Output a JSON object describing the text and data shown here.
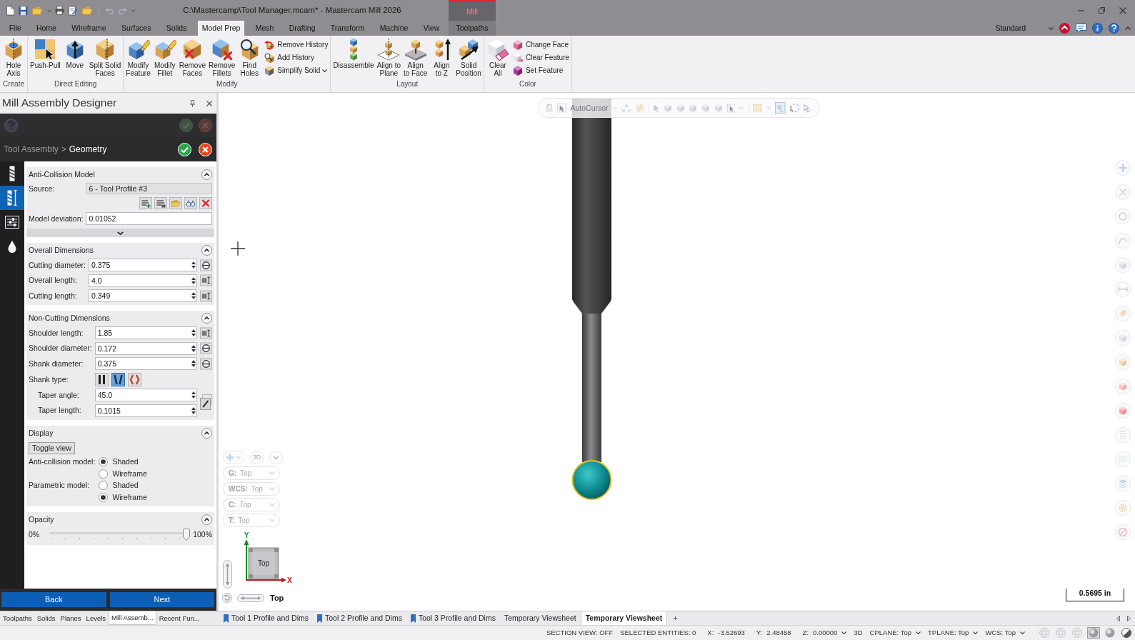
{
  "window": {
    "title": "C:\\Mastercamp\\Tool Manager.mcam* - Mastercam Mill 2026"
  },
  "ribbon": {
    "tabs": [
      {
        "label": "File",
        "selected": false
      },
      {
        "label": "Home",
        "selected": false
      },
      {
        "label": "Wireframe",
        "selected": false
      },
      {
        "label": "Surfaces",
        "selected": false
      },
      {
        "label": "Solids",
        "selected": false
      },
      {
        "label": "Model Prep",
        "selected": true
      },
      {
        "label": "Mesh",
        "selected": false
      },
      {
        "label": "Drafting",
        "selected": false
      },
      {
        "label": "Transform",
        "selected": false
      },
      {
        "label": "Machine",
        "selected": false
      },
      {
        "label": "View",
        "selected": false
      }
    ],
    "context_group": {
      "label": "Mill",
      "tabs": [
        {
          "label": "Toolpaths",
          "selected": false
        }
      ]
    },
    "workspace": "Standard",
    "groups": [
      {
        "label": "Create",
        "items": [
          {
            "kind": "large",
            "label": "Hole\nAxis"
          }
        ]
      },
      {
        "label": "Direct Editing",
        "items": [
          {
            "kind": "large",
            "label": "Push-Pull"
          },
          {
            "kind": "large",
            "label": "Move"
          },
          {
            "kind": "large",
            "label": "Split Solid\nFaces"
          }
        ]
      },
      {
        "label": "Modify",
        "items": [
          {
            "kind": "large",
            "label": "Modify\nFeature"
          },
          {
            "kind": "large",
            "label": "Modify\nFillet"
          },
          {
            "kind": "large",
            "label": "Remove\nFaces"
          },
          {
            "kind": "large",
            "label": "Remove\nFillets"
          },
          {
            "kind": "large",
            "label": "Find\nHoles"
          },
          {
            "kind": "small",
            "label": "Remove History"
          },
          {
            "kind": "small",
            "label": "Add History"
          },
          {
            "kind": "split",
            "label": "Simplify Solid"
          }
        ]
      },
      {
        "label": "Layout",
        "items": [
          {
            "kind": "large",
            "label": "Disassemble"
          },
          {
            "kind": "large",
            "label": "Align to\nPlane"
          },
          {
            "kind": "large",
            "label": "Align\nto Face"
          },
          {
            "kind": "large",
            "label": "Align\nto Z"
          },
          {
            "kind": "large",
            "label": "Solid\nPosition"
          }
        ]
      },
      {
        "label": "Color",
        "items": [
          {
            "kind": "large",
            "label": "Clear\nAll"
          },
          {
            "kind": "small",
            "label": "Change Face"
          },
          {
            "kind": "small",
            "label": "Clear Feature"
          },
          {
            "kind": "small",
            "label": "Set Feature"
          }
        ]
      }
    ]
  },
  "panel": {
    "title": "Mill Assembly Designer",
    "breadcrumb": {
      "parent": "Tool Assembly",
      "separator": ">",
      "current": "Geometry"
    },
    "side_tabs": [
      {
        "selected": false
      },
      {
        "selected": true
      },
      {
        "selected": false
      },
      {
        "selected": false
      }
    ],
    "sections": [
      {
        "kind": "source",
        "title": "Anti-Collision Model",
        "expanded": true,
        "source": {
          "label": "Source:",
          "value": "6 - Tool Profile #3"
        },
        "deviation": {
          "label": "Model deviation:",
          "value": "0.01052"
        }
      },
      {
        "kind": "fields",
        "title": "Overall Dimensions",
        "expanded": true,
        "fields": [
          {
            "kind": "diameter",
            "label": "Cutting diameter:",
            "value": "0.375"
          },
          {
            "kind": "length",
            "label": "Overall length:",
            "value": "4.0"
          },
          {
            "kind": "length",
            "label": "Cutting length:",
            "value": "0.349"
          }
        ]
      },
      {
        "kind": "fields",
        "title": "Non-Cutting Dimensions",
        "expanded": true,
        "fields": [
          {
            "kind": "length",
            "label": "Shoulder length:",
            "value": "1.85"
          },
          {
            "kind": "diameter",
            "label": "Shoulder diameter:",
            "value": "0.172"
          },
          {
            "kind": "diameter",
            "label": "Shank diameter:",
            "value": "0.375"
          },
          {
            "kind": "shank_type",
            "label": "Shank type:",
            "options": [
              {
                "selected": false
              },
              {
                "selected": true
              },
              {
                "selected": false
              }
            ]
          }
        ],
        "taper": [
          {
            "label": "Taper angle:",
            "value": "45.0"
          },
          {
            "label": "Taper length:",
            "value": "0.1015"
          }
        ]
      },
      {
        "kind": "display",
        "title": "Display",
        "expanded": true,
        "toggle": "Toggle view",
        "groups": [
          {
            "label": "Anti-collision model:",
            "options": [
              {
                "label": "Shaded",
                "selected": true
              },
              {
                "label": "Wireframe",
                "selected": false
              }
            ]
          },
          {
            "label": "Parametric model:",
            "options": [
              {
                "label": "Shaded",
                "selected": false
              },
              {
                "label": "Wireframe",
                "selected": true
              }
            ]
          }
        ]
      },
      {
        "kind": "slider",
        "title": "Opacity",
        "expanded": true,
        "min_label": "0%",
        "max_label": "100%",
        "level": 1
      }
    ],
    "buttons": [
      "Back",
      "Next"
    ],
    "tabs": [
      {
        "label": "Toolpaths",
        "selected": false
      },
      {
        "label": "Solids",
        "selected": false
      },
      {
        "label": "Planes",
        "selected": false
      },
      {
        "label": "Levels",
        "selected": false
      },
      {
        "label": "Mill Assemb...",
        "selected": true
      },
      {
        "label": "Recent Fun...",
        "selected": false
      }
    ]
  },
  "viewport": {
    "autocursor": "AutoCursor",
    "view_mode": "3D",
    "planes": [
      {
        "key": "G:",
        "value": "Top"
      },
      {
        "key": "WCS:",
        "value": "Top"
      },
      {
        "key": "C:",
        "value": "Top"
      },
      {
        "key": "T:",
        "value": "Top"
      }
    ],
    "gnomon": {
      "y_label": "Y",
      "x_label": "X",
      "cube_label": "Top"
    },
    "view_name": "Top",
    "scale": "0.5695 in"
  },
  "viewsheets": {
    "tabs": [
      {
        "label": "Tool 1 Profile and Dims",
        "pinned": true,
        "selected": false
      },
      {
        "label": "Tool 2 Profile and Dims",
        "pinned": true,
        "selected": false
      },
      {
        "label": "Tool 3 Profile and Dims",
        "pinned": true,
        "selected": false
      },
      {
        "label": "Temporary Viewsheet",
        "pinned": false,
        "selected": false
      },
      {
        "label": "Temporary Viewsheet",
        "pinned": false,
        "selected": true
      }
    ],
    "add": "+"
  },
  "status_bar": {
    "items": [
      {
        "kind": "text",
        "value": "SECTION VIEW: OFF"
      },
      {
        "kind": "text",
        "value": "SELECTED ENTITIES: 0"
      },
      {
        "kind": "text",
        "key": "X:",
        "value": "-3.52693"
      },
      {
        "kind": "text",
        "key": "Y:",
        "value": "2.48458"
      },
      {
        "kind": "dropdown",
        "key": "Z:",
        "value": "0.00000"
      },
      {
        "kind": "text",
        "value": "3D"
      },
      {
        "kind": "dropdown",
        "value": "CPLANE: Top"
      },
      {
        "kind": "dropdown",
        "value": "TPLANE: Top"
      },
      {
        "kind": "dropdown",
        "value": "WCS: Top"
      }
    ],
    "render_modes": [
      {
        "selected": false
      },
      {
        "selected": false
      },
      {
        "selected": false
      },
      {
        "selected": true
      },
      {
        "selected": false
      },
      {
        "selected": false
      }
    ]
  }
}
